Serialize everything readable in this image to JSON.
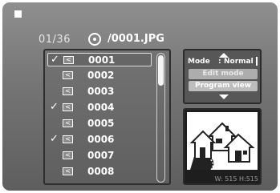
{
  "icons": {
    "stop": "stop-icon",
    "disc": "disc-icon",
    "check": "check-icon",
    "file": "file-icon",
    "arrow_up": "arrow-up-icon",
    "arrow_down": "arrow-down-icon"
  },
  "header": {
    "counter": "01/36",
    "path": "/0001.JPG"
  },
  "files": [
    {
      "name": "0001",
      "checked": true,
      "selected": true
    },
    {
      "name": "0002",
      "checked": false,
      "selected": false
    },
    {
      "name": "0003",
      "checked": false,
      "selected": false
    },
    {
      "name": "0004",
      "checked": true,
      "selected": false
    },
    {
      "name": "0005",
      "checked": false,
      "selected": false
    },
    {
      "name": "0006",
      "checked": true,
      "selected": false
    },
    {
      "name": "0007",
      "checked": false,
      "selected": false
    },
    {
      "name": "0008",
      "checked": false,
      "selected": false
    }
  ],
  "check_glyph": "✓",
  "file_glyph": "<",
  "mode_panel": {
    "label": "Mode",
    "separator": ":",
    "value": "Normal",
    "options": [
      "Edit mode",
      "Program view"
    ]
  },
  "preview": {
    "info": "W: 515  H:515"
  },
  "colors": {
    "panel_border": "#2b2b2b",
    "highlight": "#ffffff"
  }
}
